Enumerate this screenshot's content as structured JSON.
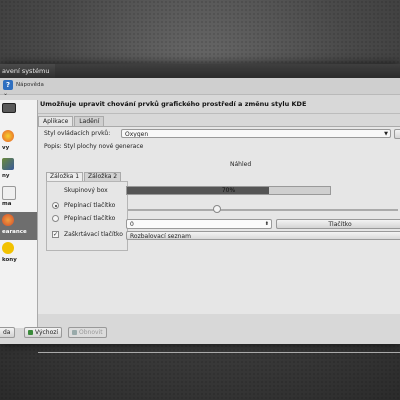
{
  "window": {
    "title": "avení systému"
  },
  "menubar": {
    "help_label": "Nápověda",
    "help_glyph": "?",
    "chevron": "⌄"
  },
  "sidebar": {
    "items": [
      {
        "label": "",
        "icon": "monitor-icon",
        "color": "#5a5a5a",
        "active": false
      },
      {
        "label": "vy",
        "icon": "colors-icon",
        "color": "#e65a2a",
        "active": false
      },
      {
        "label": "ny",
        "icon": "color-palette-icon",
        "color": "#6b8a3a",
        "active": false
      },
      {
        "label": "ma",
        "icon": "font-icon",
        "color": "#f0f0f0",
        "active": false
      },
      {
        "label": "earance",
        "icon": "application-appearance-icon",
        "color": "#d24a2a",
        "active": true
      },
      {
        "label": "kony",
        "icon": "emoticon-icon",
        "color": "#f2c200",
        "active": false
      }
    ]
  },
  "content": {
    "heading": "Umožňuje upravit chování prvků grafického prostředí a změnu stylu KDE",
    "tabs": [
      "Aplikace",
      "Ladění"
    ],
    "style_label": "Styl ovládacích prvků:",
    "style_value": "Oxygen",
    "description": "Popis: Styl plochy nové generace",
    "preview_title": "Náhled",
    "preview": {
      "tabs": [
        "Záložka 1",
        "Záložka 2"
      ],
      "group_box": "Skupinový box",
      "radio1": "Přepínací tlačítko",
      "radio2": "Přepínací tlačítko",
      "progress_text": "70%",
      "progress_value": 0.7,
      "spin_value": "0",
      "button": "Tlačítko",
      "checkbox": "Zaškrtávací tlačítko",
      "dropdown": "Rozbalovací seznam"
    }
  },
  "bottom": {
    "left_button": "da",
    "defaults_button": "Výchozí",
    "reset_button": "Obnovit"
  }
}
